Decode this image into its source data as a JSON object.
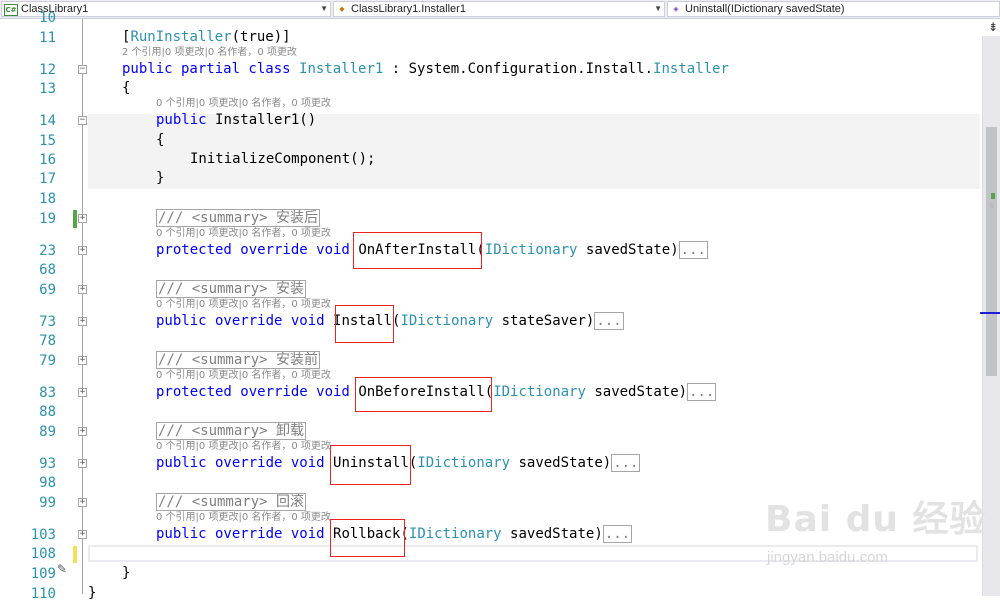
{
  "nav": {
    "project": "ClassLibrary1",
    "type": "ClassLibrary1.Installer1",
    "member": "Uninstall(IDictionary savedState)"
  },
  "gutter": {
    "lines": [
      "10",
      "11",
      "12",
      "13",
      "14",
      "15",
      "16",
      "17",
      "18",
      "19",
      "23",
      "68",
      "69",
      "73",
      "78",
      "79",
      "83",
      "88",
      "89",
      "93",
      "98",
      "99",
      "103",
      "108",
      "109",
      "110"
    ]
  },
  "code": {
    "attr_open": "[",
    "attr_name": "RunInstaller",
    "attr_args": "(true)]",
    "lens_class": "2 个引用|0 项更改|0 名作者，0 项更改",
    "class_kw": "public partial class",
    "class_name": "Installer1",
    "class_sep": " : ",
    "base_ns": "System.Configuration.Install.",
    "base_type": "Installer",
    "brace_open": "{",
    "lens_ctor": "0 个引用|0 项更改|0 名作者，0 项更改",
    "ctor_kw": "public",
    "ctor_name": "Installer1()",
    "ctor_open": "{",
    "ctor_body": "InitializeComponent();",
    "ctor_close": "}",
    "lens": "0 个引用|0 项更改|0 名作者，0 项更改",
    "ellipsis": "...",
    "class_close": "}",
    "ns_close": "}",
    "methods": [
      {
        "summary": "/// <summary> 安装后",
        "mods": "protected override void",
        "name": "OnAfterInstall",
        "ptype": "IDictionary",
        "pname": " savedState)"
      },
      {
        "summary": "/// <summary> 安装",
        "mods": "public override void",
        "name": "Install",
        "ptype": "IDictionary",
        "pname": " stateSaver)"
      },
      {
        "summary": "/// <summary> 安装前",
        "mods": "protected override void",
        "name": "OnBeforeInstall",
        "ptype": "IDictionary",
        "pname": " savedState)"
      },
      {
        "summary": "/// <summary> 卸载",
        "mods": "public override void",
        "name": "Uninstall",
        "ptype": "IDictionary",
        "pname": " savedState)"
      },
      {
        "summary": "/// <summary> 回滚",
        "mods": "public override void",
        "name": "Rollback",
        "ptype": "IDictionary",
        "pname": " savedState)"
      }
    ]
  },
  "watermark": {
    "logo": "Bai du 经验",
    "url": "jingyan.baidu.com"
  },
  "colors": {
    "keyword": "#0000ff",
    "type": "#2b91af",
    "comment": "#808080",
    "highlight_box": "#ee2222"
  }
}
